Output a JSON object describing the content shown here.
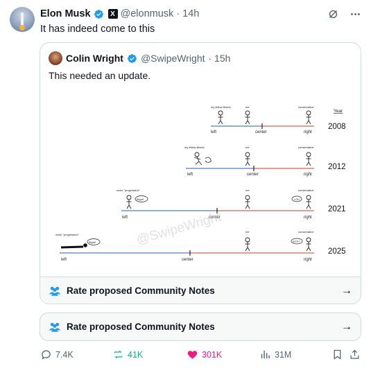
{
  "tweet": {
    "author_name": "Elon Musk",
    "handle": "@elonmusk",
    "time": "· 14h",
    "x_badge": "X",
    "text": "It has indeed come to this"
  },
  "quote": {
    "author_name": "Colin Wright",
    "handle": "@SwipeWright",
    "time": "· 15h",
    "text": "This needed an update.",
    "notes_label": "Rate proposed Community Notes",
    "image": {
      "year_header": "Year",
      "watermark": "@SwipeWright",
      "rows": [
        {
          "year": "2008",
          "left": "left",
          "center": "center",
          "right": "right",
          "label_liberal": "my fellow liberal",
          "label_me": "me",
          "label_conservative": "conservative"
        },
        {
          "year": "2012",
          "left": "left",
          "center": "center",
          "right": "right",
          "label_liberal": "my fellow liberal",
          "label_me": "me",
          "label_conservative": "conservative"
        },
        {
          "year": "2021",
          "left": "left",
          "center": "center",
          "right": "right",
          "label_liberal": "woke \"progressive\"",
          "label_me": "me",
          "label_conservative": "conservative",
          "bubble_left": "Bigot!",
          "bubble_right": "LOL!"
        },
        {
          "year": "2025",
          "left": "left",
          "center": "center",
          "right": "right",
          "label_liberal": "woke \"progressive\"",
          "label_me": "me",
          "label_conservative": "conservative",
          "bubble_left": "Bigot!",
          "bubble_right": "WTF?"
        }
      ]
    }
  },
  "notes_bar": {
    "label": "Rate proposed Community Notes"
  },
  "actions": {
    "replies": "7.4K",
    "reposts": "41K",
    "likes": "301K",
    "views": "31M"
  },
  "colors": {
    "blue": "#1d9bf0",
    "green": "#00ba7c",
    "pink": "#f91880",
    "line_left": "#4a7fc1",
    "line_right": "#d9634a"
  }
}
